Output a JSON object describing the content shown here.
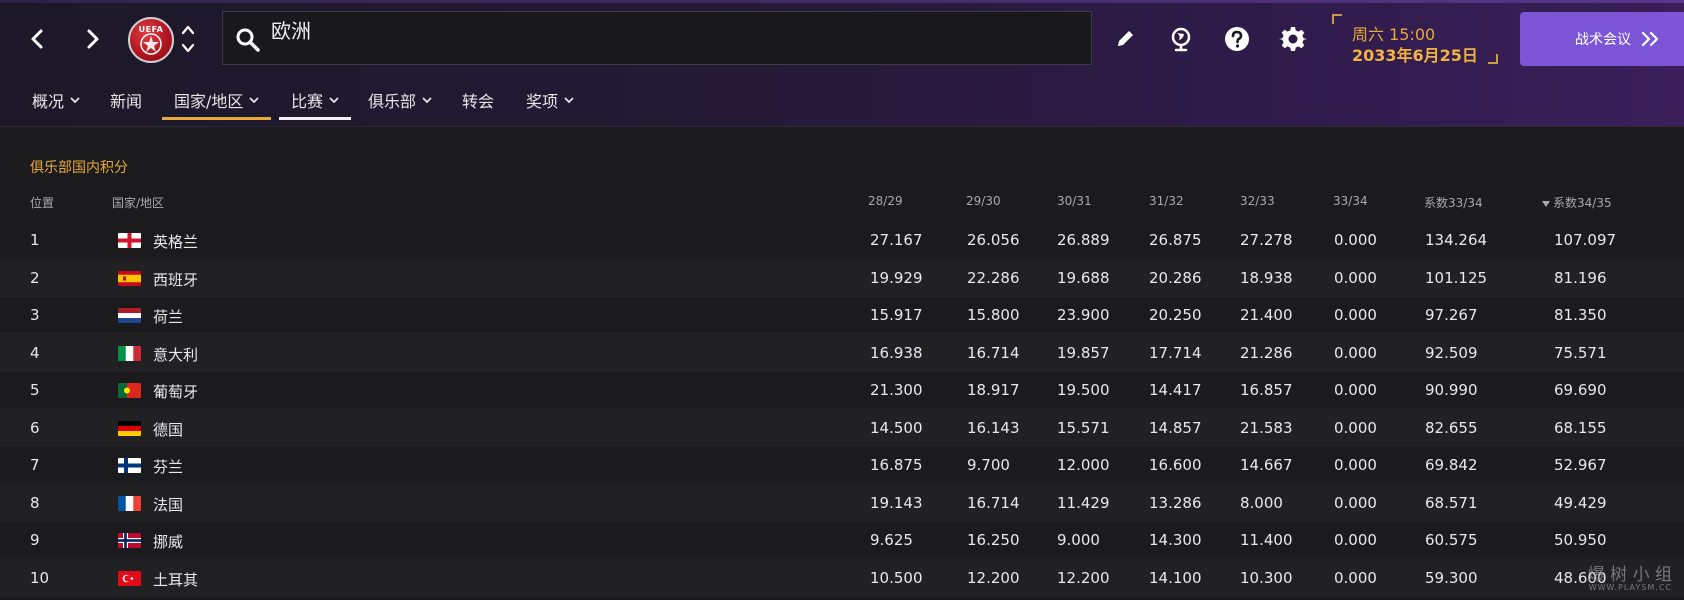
{
  "header": {
    "search_value": "欧洲",
    "uefa_text": "UEFA",
    "time": "周六 15:00",
    "date": "2033年6月25日",
    "tactics_label": "战术会议"
  },
  "tabs": [
    {
      "label": "概况",
      "has_dropdown": true
    },
    {
      "label": "新闻",
      "has_dropdown": false
    },
    {
      "label": "国家/地区",
      "has_dropdown": true,
      "active": "orange"
    },
    {
      "label": "比赛",
      "has_dropdown": true,
      "active": "white"
    },
    {
      "label": "俱乐部",
      "has_dropdown": true
    },
    {
      "label": "转会",
      "has_dropdown": false
    },
    {
      "label": "奖项",
      "has_dropdown": true
    }
  ],
  "section_title": "俱乐部国内积分",
  "table": {
    "headers": [
      "位置",
      "国家/地区",
      "28/29",
      "29/30",
      "30/31",
      "31/32",
      "32/33",
      "33/34",
      "系数33/34",
      "系数34/35"
    ],
    "sorted_column": "系数34/35",
    "rows": [
      {
        "pos": "1",
        "country": "英格兰",
        "flag": "england",
        "v": [
          "27.167",
          "26.056",
          "26.889",
          "26.875",
          "27.278",
          "0.000",
          "134.264",
          "107.097"
        ]
      },
      {
        "pos": "2",
        "country": "西班牙",
        "flag": "spain",
        "v": [
          "19.929",
          "22.286",
          "19.688",
          "20.286",
          "18.938",
          "0.000",
          "101.125",
          "81.196"
        ]
      },
      {
        "pos": "3",
        "country": "荷兰",
        "flag": "netherlands",
        "v": [
          "15.917",
          "15.800",
          "23.900",
          "20.250",
          "21.400",
          "0.000",
          "97.267",
          "81.350"
        ]
      },
      {
        "pos": "4",
        "country": "意大利",
        "flag": "italy",
        "v": [
          "16.938",
          "16.714",
          "19.857",
          "17.714",
          "21.286",
          "0.000",
          "92.509",
          "75.571"
        ]
      },
      {
        "pos": "5",
        "country": "葡萄牙",
        "flag": "portugal",
        "v": [
          "21.300",
          "18.917",
          "19.500",
          "14.417",
          "16.857",
          "0.000",
          "90.990",
          "69.690"
        ]
      },
      {
        "pos": "6",
        "country": "德国",
        "flag": "germany",
        "v": [
          "14.500",
          "16.143",
          "15.571",
          "14.857",
          "21.583",
          "0.000",
          "82.655",
          "68.155"
        ]
      },
      {
        "pos": "7",
        "country": "芬兰",
        "flag": "finland",
        "v": [
          "16.875",
          "9.700",
          "12.000",
          "16.600",
          "14.667",
          "0.000",
          "69.842",
          "52.967"
        ]
      },
      {
        "pos": "8",
        "country": "法国",
        "flag": "france",
        "v": [
          "19.143",
          "16.714",
          "11.429",
          "13.286",
          "8.000",
          "0.000",
          "68.571",
          "49.429"
        ]
      },
      {
        "pos": "9",
        "country": "挪威",
        "flag": "norway",
        "v": [
          "9.625",
          "16.250",
          "9.000",
          "14.300",
          "11.400",
          "0.000",
          "60.575",
          "50.950"
        ]
      },
      {
        "pos": "10",
        "country": "土耳其",
        "flag": "turkey",
        "v": [
          "10.500",
          "12.200",
          "12.200",
          "14.100",
          "10.300",
          "0.000",
          "59.300",
          "48.600"
        ]
      }
    ]
  },
  "watermark": {
    "main": "爆 树 小 组",
    "sub": "WWW.PLAYSM.CC"
  },
  "colors": {
    "accent_orange": "#e7a83c",
    "button_purple": "#7b55d6",
    "background": "#1b1b1d"
  }
}
